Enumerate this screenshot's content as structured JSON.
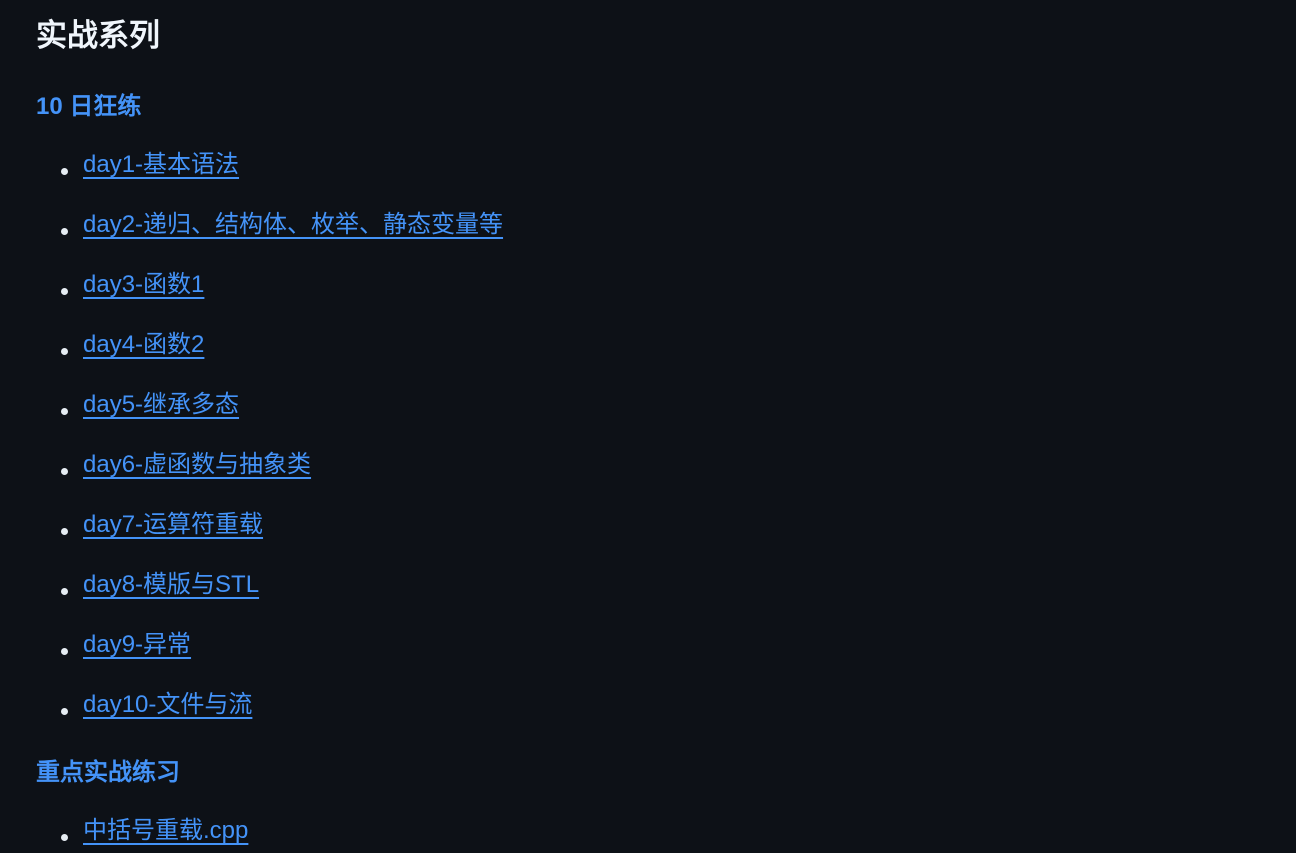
{
  "page": {
    "title": "实战系列"
  },
  "sections": [
    {
      "heading": "10 日狂练",
      "links": [
        "day1-基本语法",
        "day2-递归、结构体、枚举、静态变量等",
        "day3-函数1",
        "day4-函数2",
        "day5-继承多态",
        "day6-虚函数与抽象类",
        "day7-运算符重载",
        "day8-模版与STL",
        "day9-异常",
        "day10-文件与流"
      ]
    },
    {
      "heading": "重点实战练习",
      "links": [
        "中括号重载.cpp"
      ]
    }
  ],
  "colors": {
    "background": "#0d1117",
    "title": "#f0f6fc",
    "link": "#4493f8",
    "bullet": "#e6edf3"
  }
}
